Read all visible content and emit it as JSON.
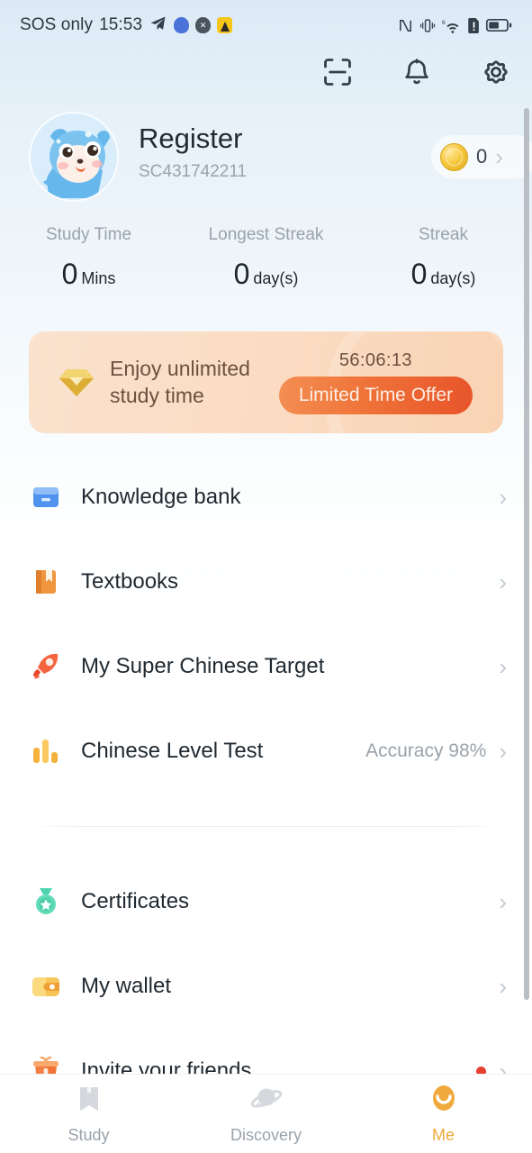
{
  "status_bar": {
    "carrier": "SOS only",
    "time": "15:53",
    "left_icons": [
      "telegram-icon",
      "shield-blue-icon",
      "shield-dark-icon",
      "app-yellow-icon"
    ],
    "right_icons": [
      "nfc-icon",
      "vibrate-icon",
      "wifi6-icon",
      "sim-alert-icon",
      "battery-icon"
    ]
  },
  "header": {
    "icons": [
      {
        "name": "scan-icon",
        "label": "Scan"
      },
      {
        "name": "bell-icon",
        "label": "Notifications"
      },
      {
        "name": "gear-icon",
        "label": "Settings"
      }
    ]
  },
  "profile": {
    "avatar": "mascot-avatar",
    "name": "Register",
    "user_id": "SC431742211",
    "coins": "0",
    "coin_chevron": "›"
  },
  "stats": [
    {
      "label": "Study Time",
      "value": "0",
      "unit": "Mins"
    },
    {
      "label": "Longest Streak",
      "value": "0",
      "unit": "day(s)"
    },
    {
      "label": "Streak",
      "value": "0",
      "unit": "day(s)"
    }
  ],
  "promo": {
    "icon": "diamond-icon",
    "title_line1": "Enjoy unlimited",
    "title_line2": "study time",
    "timer": "56:06:13",
    "button": "Limited Time Offer",
    "bg_color": "#fae2ce",
    "button_color": "#ef7339"
  },
  "menu_groups": [
    {
      "items": [
        {
          "icon": "knowledge-bank-icon",
          "label": "Knowledge bank",
          "trailing": "",
          "badge": false,
          "chevron": "›"
        },
        {
          "icon": "textbook-icon",
          "label": "Textbooks",
          "trailing": "",
          "badge": false,
          "chevron": "›"
        },
        {
          "icon": "rocket-icon",
          "label": "My Super Chinese Target",
          "trailing": "",
          "badge": false,
          "chevron": "›"
        },
        {
          "icon": "bar-chart-icon",
          "label": "Chinese Level Test",
          "trailing": "Accuracy 98%",
          "badge": false,
          "chevron": "›"
        }
      ]
    },
    {
      "items": [
        {
          "icon": "medal-icon",
          "label": "Certificates",
          "trailing": "",
          "badge": false,
          "chevron": "›"
        },
        {
          "icon": "wallet-icon",
          "label": "My wallet",
          "trailing": "",
          "badge": false,
          "chevron": "›"
        },
        {
          "icon": "gift-icon",
          "label": "Invite your friends",
          "trailing": "",
          "badge": true,
          "chevron": "›"
        }
      ]
    }
  ],
  "bottom_nav": {
    "active": "Me",
    "items": [
      {
        "icon": "book-icon",
        "label": "Study"
      },
      {
        "icon": "planet-icon",
        "label": "Discovery"
      },
      {
        "icon": "smiley-icon",
        "label": "Me"
      }
    ]
  },
  "accent_color": "#f0a93c"
}
